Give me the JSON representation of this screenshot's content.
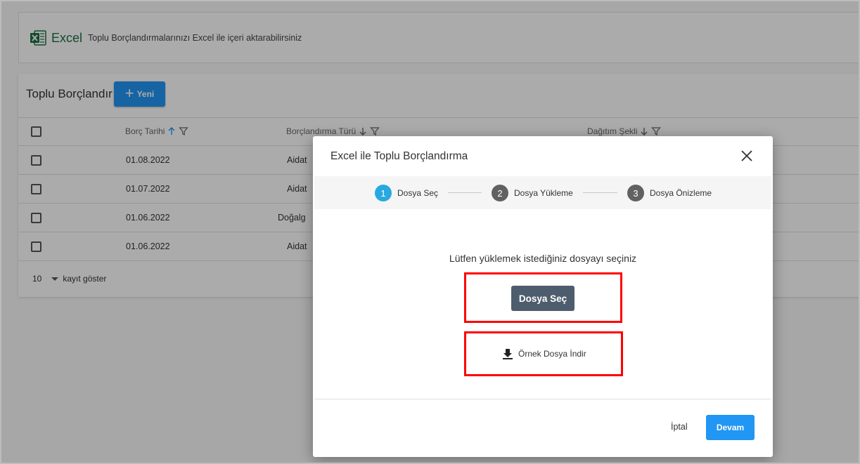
{
  "banner": {
    "logo_text": "Excel",
    "description": "Toplu Borçlandırmalarınızı Excel ile içeri aktarabilirsiniz"
  },
  "grid": {
    "title": "Toplu Borçlandır",
    "new_button_label": "Yeni",
    "columns": [
      {
        "label": "Borç Tarihi",
        "sort": "asc"
      },
      {
        "label": "Borçlandırma Türü",
        "sort": "desc"
      },
      {
        "label": "Dağıtım Şekli",
        "sort": "desc"
      }
    ],
    "rows": [
      {
        "date": "01.08.2022",
        "type": "Aidat"
      },
      {
        "date": "01.07.2022",
        "type": "Aidat"
      },
      {
        "date": "01.06.2022",
        "type": "Doğalg"
      },
      {
        "date": "01.06.2022",
        "type": "Aidat"
      }
    ],
    "page_size": "10",
    "page_size_label": "kayıt göster"
  },
  "modal": {
    "title": "Excel ile Toplu Borçlandırma",
    "steps": [
      {
        "number": "1",
        "label": "Dosya Seç",
        "active": true
      },
      {
        "number": "2",
        "label": "Dosya Yükleme",
        "active": false
      },
      {
        "number": "3",
        "label": "Dosya Önizleme",
        "active": false
      }
    ],
    "prompt": "Lütfen yüklemek istediğiniz dosyayı seçiniz",
    "select_button_label": "Dosya Seç",
    "download_label": "Örnek Dosya İndir",
    "cancel_label": "İptal",
    "continue_label": "Devam"
  },
  "colors": {
    "primary": "#2196f3",
    "step_active": "#29a8e0",
    "step_inactive": "#616161",
    "select_button": "#4e5d6d",
    "highlight": "#ff0000",
    "excel_green": "#1d6f42"
  }
}
